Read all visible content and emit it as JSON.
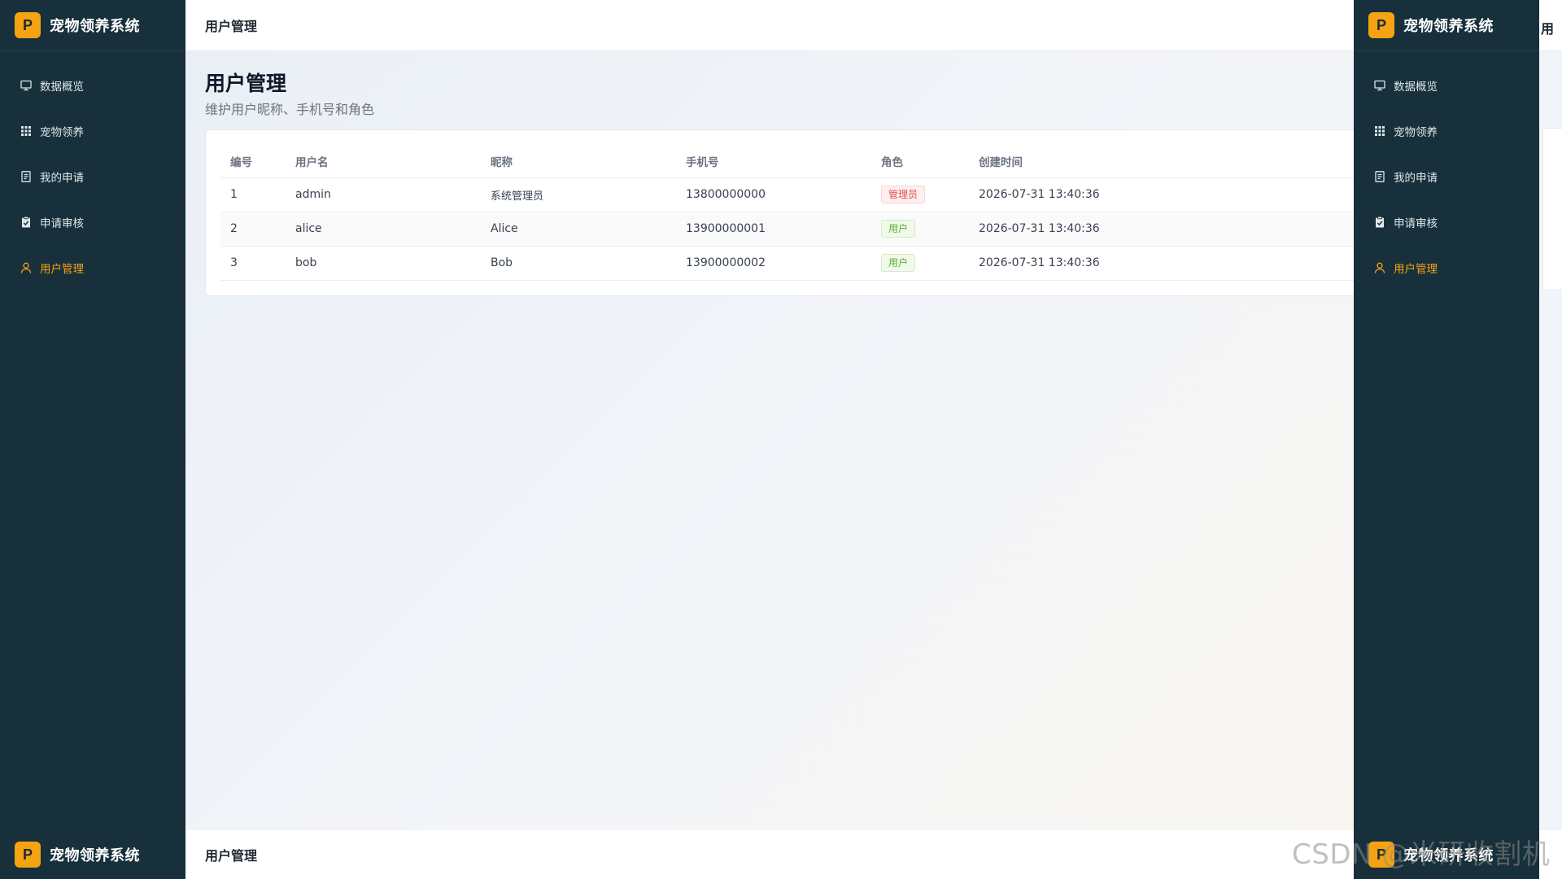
{
  "brand": {
    "logo_letter": "P",
    "title": "宠物领养系统"
  },
  "menu": [
    {
      "label": "数据概览",
      "icon": "monitor-icon",
      "active": false
    },
    {
      "label": "宠物领养",
      "icon": "grid-icon",
      "active": false
    },
    {
      "label": "我的申请",
      "icon": "document-icon",
      "active": false
    },
    {
      "label": "申请审核",
      "icon": "clipboard-check-icon",
      "active": false
    },
    {
      "label": "用户管理",
      "icon": "user-icon",
      "active": true
    }
  ],
  "header": {
    "title": "用户管理"
  },
  "page": {
    "title": "用户管理",
    "subtitle": "维护用户昵称、手机号和角色"
  },
  "table": {
    "columns": [
      "编号",
      "用户名",
      "昵称",
      "手机号",
      "角色",
      "创建时间"
    ],
    "rows": [
      {
        "id": "1",
        "username": "admin",
        "nickname": "系统管理员",
        "phone": "13800000000",
        "role": "管理员",
        "role_type": "admin",
        "created": "2026-07-31 13:40:36"
      },
      {
        "id": "2",
        "username": "alice",
        "nickname": "Alice",
        "phone": "13900000001",
        "role": "用户",
        "role_type": "user",
        "created": "2026-07-31 13:40:36"
      },
      {
        "id": "3",
        "username": "bob",
        "nickname": "Bob",
        "phone": "13900000002",
        "role": "用户",
        "role_type": "user",
        "created": "2026-07-31 13:40:36"
      }
    ]
  },
  "right_peek": {
    "header_fragment": "用"
  },
  "watermark": "CSDN @米研收割机",
  "colors": {
    "sidebar_bg": "#17303b",
    "accent": "#f5a312",
    "admin_tag": "#e2504b",
    "user_tag": "#52b12a"
  }
}
